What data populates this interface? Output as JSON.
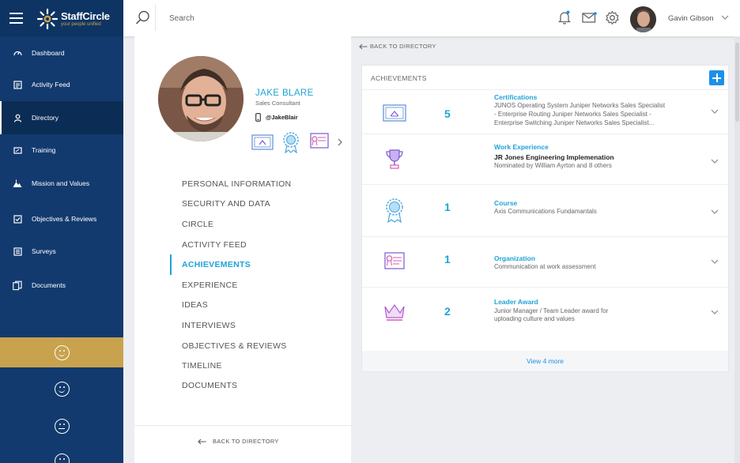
{
  "app": {
    "logo_name": "StaffCircle",
    "logo_tagline": "your people unified",
    "colors": {
      "sidebar": "#123a6e",
      "accent": "#1fa3d8",
      "gold": "#c9a24d",
      "button": "#1e90e8"
    }
  },
  "sidebar": {
    "items": [
      {
        "label": "Dashboard",
        "icon": "dashboard-icon"
      },
      {
        "label": "Activity Feed",
        "icon": "feed-icon"
      },
      {
        "label": "Directory",
        "icon": "person-icon",
        "active": true
      },
      {
        "label": "Training",
        "icon": "training-icon"
      },
      {
        "label": "Mission and Values",
        "icon": "mountain-icon"
      },
      {
        "label": "Objectives & Reviews",
        "icon": "checklist-icon"
      },
      {
        "label": "Surveys",
        "icon": "survey-icon"
      },
      {
        "label": "Documents",
        "icon": "documents-icon"
      }
    ],
    "moods": [
      "happy-face-icon",
      "smile-face-icon",
      "neutral-face-icon",
      "sad-face-icon"
    ]
  },
  "header": {
    "search_placeholder": "Search",
    "user_name": "Gavin Gibson"
  },
  "profile": {
    "name": "JAKE BLARE",
    "title": "Sales Consultant",
    "handle": "@JakeBlair",
    "menu": [
      "PERSONAL INFORMATION",
      "SECURITY AND DATA",
      "CIRCLE",
      "ACTIVITY FEED",
      "ACHIEVEMENTS",
      "EXPERIENCE",
      "IDEAS",
      "INTERVIEWS",
      "OBJECTIVES & REVIEWS",
      "TIMELINE",
      "DOCUMENTS"
    ],
    "active_menu": "ACHIEVEMENTS",
    "back_label": "BACK TO DIRECTORY"
  },
  "main": {
    "breadcrumb": "BACK TO DIRECTORY",
    "card_title": "ACHIEVEMENTS",
    "rows": [
      {
        "icon": "certificate-icon",
        "count": "5",
        "category": "Certifications",
        "strong": "",
        "desc": [
          "JUNOS Operating System Juniper Networks Sales Specialist",
          "- Enterprise Routing Juniper Networks Sales Specialist -",
          "Enterprise Switching Juniper Networks Sales Specialist..."
        ]
      },
      {
        "icon": "trophy-icon",
        "count": "",
        "category": "Work Experience",
        "strong": "JR Jones Engineering Implemenation",
        "desc": [
          "Nominated by William Ayrton and 8 others"
        ]
      },
      {
        "icon": "rosette-icon",
        "count": "1",
        "category": "Course",
        "strong": "",
        "desc": [
          "Axis Communications Fundamantals"
        ]
      },
      {
        "icon": "diploma-icon",
        "count": "1",
        "category": "Organization",
        "strong": "",
        "desc": [
          "Communication at work assessment"
        ]
      },
      {
        "icon": "crown-icon",
        "count": "2",
        "category": "Leader Award",
        "strong": "",
        "desc": [
          "Junior Manager / Team Leader award for",
          "uploading culture and values"
        ]
      }
    ],
    "view_more": "View 4 more"
  }
}
